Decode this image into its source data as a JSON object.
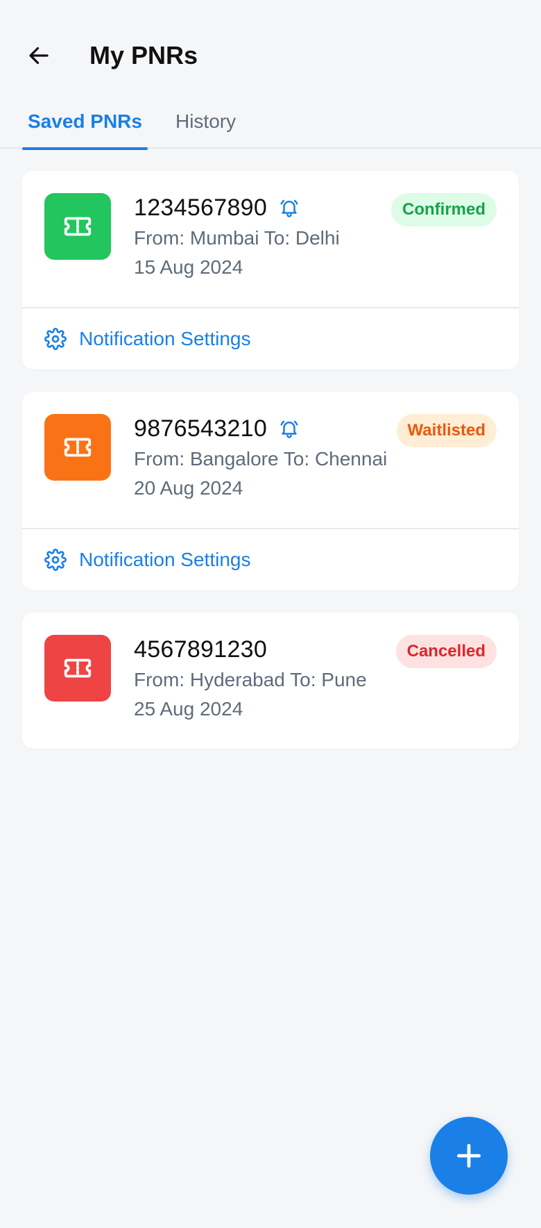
{
  "header": {
    "title": "My PNRs"
  },
  "tabs": [
    {
      "label": "Saved PNRs",
      "active": true
    },
    {
      "label": "History",
      "active": false
    }
  ],
  "colors": {
    "accent": "#1a7fe6",
    "confirmed_tile": "#22c55e",
    "waitlisted_tile": "#f97316",
    "cancelled_tile": "#ef4444",
    "confirmed_badge_bg": "#dcfce7",
    "confirmed_badge_text": "#16a34a",
    "waitlisted_badge_bg": "#ffedd5",
    "waitlisted_badge_text": "#ea580c",
    "cancelled_badge_bg": "#fee2e2",
    "cancelled_badge_text": "#dc2626"
  },
  "pnrs": [
    {
      "number": "1234567890",
      "route": "From: Mumbai To: Delhi",
      "date": "15 Aug 2024",
      "status": "Confirmed",
      "alerts_on": true,
      "settings_label": "Notification Settings"
    },
    {
      "number": "9876543210",
      "route": "From: Bangalore To: Chennai",
      "date": "20 Aug 2024",
      "status": "Waitlisted",
      "alerts_on": true,
      "settings_label": "Notification Settings"
    },
    {
      "number": "4567891230",
      "route": "From: Hyderabad To: Pune",
      "date": "25 Aug 2024",
      "status": "Cancelled",
      "alerts_on": false
    }
  ],
  "icons": {
    "back": "arrow-left-icon",
    "ticket": "ticket-icon",
    "bell": "bell-icon",
    "settings": "gear-icon",
    "add": "plus-icon"
  }
}
